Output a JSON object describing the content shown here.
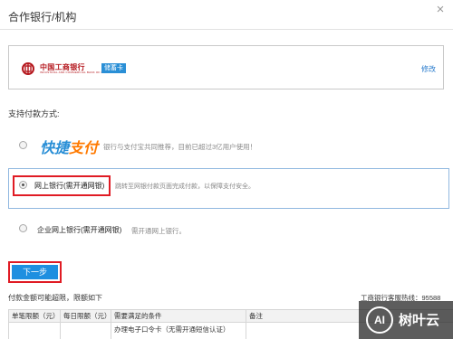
{
  "dialog": {
    "title": "合作银行/机构",
    "close_glyph": "×"
  },
  "bank": {
    "name": "中国工商银行",
    "sub_name": "INDUSTRIAL AND COMMERCIAL BANK OF CHINA",
    "card_type": "储蓄卡",
    "edit_label": "修改",
    "brand_color": "#b4161c"
  },
  "payment": {
    "section_label": "支持付款方式:",
    "options": [
      {
        "logo_part1": "快捷",
        "logo_part2": "支付",
        "description": "银行与支付宝共同推荐，目前已超过3亿用户使用！",
        "selected": false
      },
      {
        "label": "网上银行(需开通网银)",
        "description": "跳转至网银付款页面完成付款，以保障支付安全。",
        "selected": true
      },
      {
        "label": "企业网上银行(需开通网银)",
        "description": "需开通网上银行。",
        "selected": false
      }
    ]
  },
  "actions": {
    "next_label": "下一步",
    "accent_color": "#1e8fe0",
    "highlight_color": "#e01b24"
  },
  "limits": {
    "note": "付款金额可能超限，限额如下",
    "hotline": "工商银行客服热线：95588",
    "headers": [
      "单笔限额（元）",
      "每日限额（元）",
      "需要满足的条件",
      "备注"
    ],
    "rows": [
      [
        "",
        "",
        "办理电子口令卡（无需开通短信认证）",
        ""
      ]
    ]
  },
  "watermark": {
    "icon_text": "AI",
    "text": "树叶云"
  }
}
